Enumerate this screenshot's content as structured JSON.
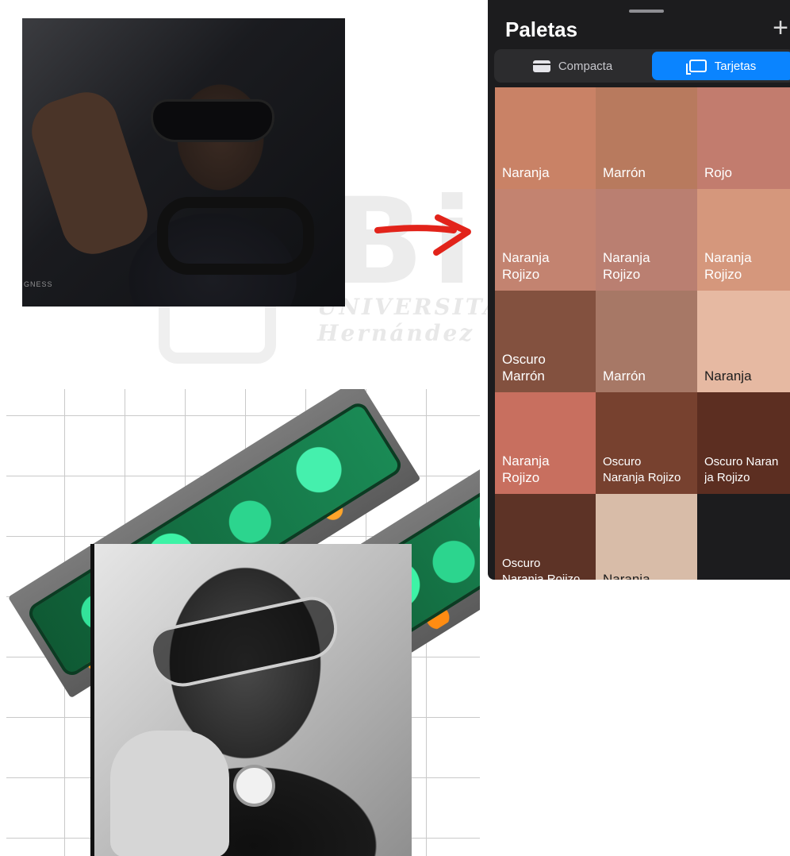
{
  "watermark": {
    "word": "Biblioteca",
    "sub": "UNIVERSITAS Miguel Hernández"
  },
  "photo_top": {
    "caption": "GNESS"
  },
  "palette_panel": {
    "title": "Paletas",
    "add_label": "+",
    "tabs": [
      {
        "label": "Compacta",
        "icon": "compact-view-icon",
        "selected": false
      },
      {
        "label": "Tarjetas",
        "icon": "cards-view-icon",
        "selected": true
      }
    ],
    "accent_color": "#0a84ff",
    "swatches": [
      {
        "label": "Naranja",
        "color": "#c98266"
      },
      {
        "label": "Marrón",
        "color": "#b87a5e"
      },
      {
        "label": "Rojo",
        "color": "#c27c6e"
      },
      {
        "label": "Naranja\nRojizo",
        "color": "#c38370"
      },
      {
        "label": "Naranja\nRojizo",
        "color": "#ba7f71"
      },
      {
        "label": "Naranja\nRojizo",
        "color": "#d5977c"
      },
      {
        "label": "Oscuro\nMarrón",
        "color": "#83513f"
      },
      {
        "label": "Marrón",
        "color": "#a77866"
      },
      {
        "label": "Naranja",
        "color": "#e6b9a2"
      },
      {
        "label": "Naranja\nRojizo",
        "color": "#c86f5f"
      },
      {
        "label": "Oscuro\nNaranja Rojizo",
        "color": "#77412f"
      },
      {
        "label": "Oscuro Naran\nja Rojizo",
        "color": "#5c2e21"
      },
      {
        "label": "Oscuro\nNaranja Rojizo",
        "color": "#5d3326"
      },
      {
        "label": "Naranja",
        "color": "#d8bca8"
      },
      {
        "label": "",
        "color": "#1c1c1e"
      }
    ]
  }
}
